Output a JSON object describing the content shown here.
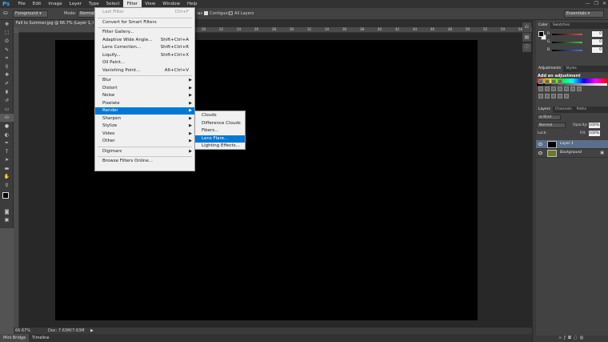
{
  "app": {
    "logo": "Ps"
  },
  "menubar": {
    "items": [
      "File",
      "Edit",
      "Image",
      "Layer",
      "Type",
      "Select",
      "Filter",
      "View",
      "Window",
      "Help"
    ],
    "active": "Filter"
  },
  "window_controls": {
    "minimize": "—",
    "restore": "❐",
    "close": "✕"
  },
  "options": {
    "preset": "Foreground",
    "mode_label": "Mode:",
    "mode_value": "Normal",
    "contiguous": "Contiguous",
    "all_layers": "All Layers",
    "partial_label": "ias",
    "workspace": "Essentials"
  },
  "document": {
    "tab_title": "Fall to Summer.jpg @ 66.7% (Layer 1, RGB/8)",
    "zoom": "66.67%",
    "doc_info": "Doc: 7.63M/7.63M",
    "ruler_marks": [
      "20",
      "22",
      "24",
      "26",
      "28",
      "30",
      "32",
      "34",
      "36",
      "38",
      "40",
      "42",
      "44",
      "46",
      "48",
      "50",
      "52",
      "54",
      "56"
    ]
  },
  "bottom_tabs": [
    "Mini Bridge",
    "Timeline"
  ],
  "filter_menu": {
    "items": [
      {
        "label": "Last Filter",
        "shortcut": "Ctrl+F",
        "disabled": true
      },
      {
        "sep": true
      },
      {
        "label": "Convert for Smart Filters"
      },
      {
        "sep": true
      },
      {
        "label": "Filter Gallery..."
      },
      {
        "label": "Adaptive Wide Angle...",
        "shortcut": "Shift+Ctrl+A"
      },
      {
        "label": "Lens Correction...",
        "shortcut": "Shift+Ctrl+R"
      },
      {
        "label": "Liquify...",
        "shortcut": "Shift+Ctrl+X"
      },
      {
        "label": "Oil Paint..."
      },
      {
        "label": "Vanishing Point...",
        "shortcut": "Alt+Ctrl+V"
      },
      {
        "sep": true
      },
      {
        "label": "Blur",
        "submenu": true
      },
      {
        "label": "Distort",
        "submenu": true
      },
      {
        "label": "Noise",
        "submenu": true
      },
      {
        "label": "Pixelate",
        "submenu": true
      },
      {
        "label": "Render",
        "submenu": true,
        "highlighted": true
      },
      {
        "label": "Sharpen",
        "submenu": true
      },
      {
        "label": "Stylize",
        "submenu": true
      },
      {
        "label": "Video",
        "submenu": true
      },
      {
        "label": "Other",
        "submenu": true
      },
      {
        "sep": true
      },
      {
        "label": "Digimarc",
        "submenu": true
      },
      {
        "sep": true
      },
      {
        "label": "Browse Filters Online..."
      }
    ]
  },
  "render_submenu": {
    "items": [
      {
        "label": "Clouds"
      },
      {
        "label": "Difference Clouds"
      },
      {
        "label": "Fibers..."
      },
      {
        "label": "Lens Flare...",
        "highlighted": true
      },
      {
        "label": "Lighting Effects..."
      }
    ]
  },
  "color_panel": {
    "tabs": [
      "Color",
      "Swatches"
    ],
    "sliders": [
      {
        "label": "R",
        "value": "0",
        "color": "#e05050"
      },
      {
        "label": "G",
        "value": "0",
        "color": "#50c050"
      },
      {
        "label": "B",
        "value": "0",
        "color": "#5070e0"
      }
    ]
  },
  "adjustments_panel": {
    "tabs": [
      "Adjustments",
      "Styles"
    ],
    "title": "Add an adjustment"
  },
  "layers_panel": {
    "tabs": [
      "Layers",
      "Channels",
      "Paths"
    ],
    "kind": "Kind",
    "blend_mode": "Normal",
    "opacity_label": "Opacity:",
    "opacity": "100%",
    "lock_label": "Lock:",
    "fill_label": "Fill:",
    "fill": "100%",
    "layers": [
      {
        "name": "Layer 1",
        "selected": true,
        "thumb": "#000000"
      },
      {
        "name": "Background",
        "selected": false,
        "thumb": "#6b7a2a",
        "locked": true
      }
    ]
  },
  "colors": {
    "menu_highlight": "#0078d7",
    "canvas": "#000000",
    "ps_blue": "#31a8ff"
  }
}
